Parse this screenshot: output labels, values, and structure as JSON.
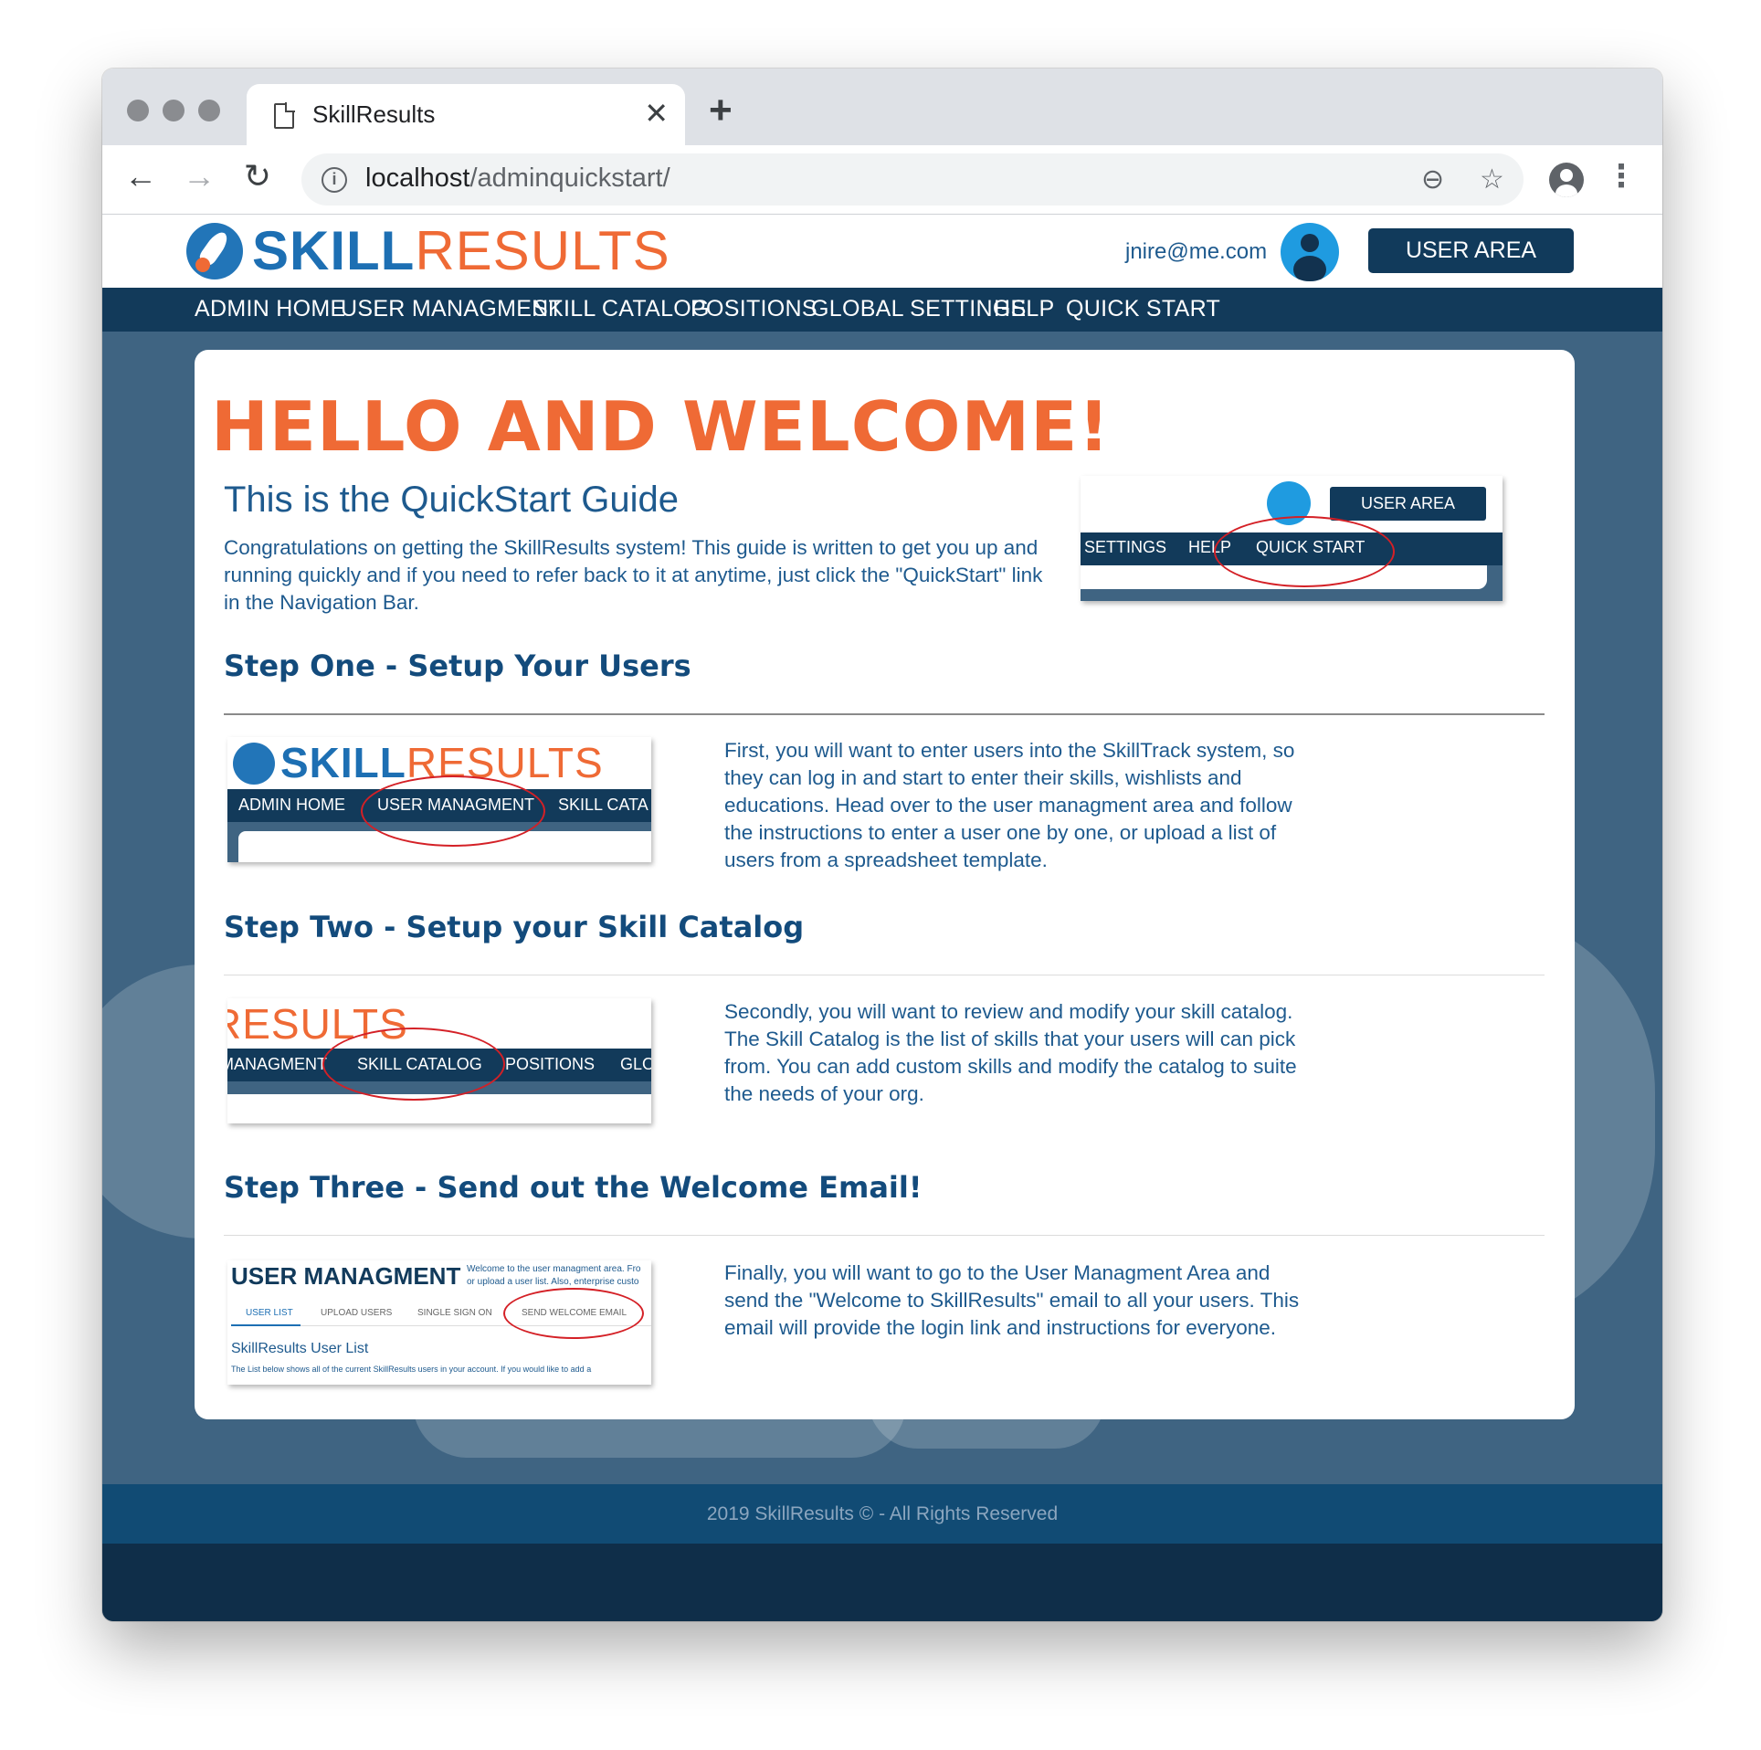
{
  "browser": {
    "tab_title": "SkillResults",
    "tab_close": "✕",
    "new_tab": "+",
    "url_host": "localhost",
    "url_path": "/adminquickstart/",
    "back": "←",
    "forward": "→",
    "reload": "↻",
    "info": "i",
    "zoom_icon": "⊖",
    "star_icon": "☆",
    "menu": "⋮"
  },
  "header": {
    "logo_skill": "SKILL",
    "logo_results": "RESULTS",
    "user_email": "jnire@me.com",
    "user_area_label": "USER AREA"
  },
  "nav": {
    "items": [
      "ADMIN HOME",
      "USER MANAGMENT",
      "SKILL CATALOG",
      "POSITIONS",
      "GLOBAL SETTINGS",
      "HELP",
      "QUICK START"
    ]
  },
  "main": {
    "hero": "HELLO AND WELCOME!",
    "guide_title": "This is the QuickStart Guide",
    "guide_text": "Congratulations on getting the SkillResults system! This guide is written to get you up and running quickly and if you need to refer back to it at anytime, just click the \"QuickStart\" link in the Navigation Bar.",
    "quickstart_thumb": {
      "user_area": "USER AREA",
      "nav": [
        "SETTINGS",
        "HELP",
        "QUICK START"
      ]
    },
    "steps": [
      {
        "title": "Step One - Setup Your Users",
        "text": "First, you will want to enter users into the SkillTrack system, so they can log in and start to enter their skills, wishlists and educations. Head over to the user managment area and follow the instructions to enter a user one by one, or upload a list of users from a spreadsheet template.",
        "thumb": {
          "logo_skill": "SKILL",
          "logo_results": "RESULTS",
          "nav": [
            "ADMIN HOME",
            "USER MANAGMENT",
            "SKILL CATA"
          ]
        }
      },
      {
        "title": "Step Two - Setup your Skill Catalog",
        "text": "Secondly, you will want to review and modify your skill catalog. The Skill Catalog is the list of skills that your users will can pick from. You can add custom skills and modify the catalog to suite the needs of your org.",
        "thumb": {
          "logo_results": "RESULTS",
          "nav": [
            "MANAGMENT",
            "SKILL CATALOG",
            "POSITIONS",
            "GLO"
          ]
        }
      },
      {
        "title": "Step Three - Send out the Welcome Email!",
        "text": "Finally, you will want to go to the User Managment Area and send the \"Welcome to SkillResults\" email to all your users. This email will provide the login link and instructions for everyone.",
        "thumb": {
          "heading": "USER MANAGMENT",
          "blurb_1": "Welcome to the user managment area. Fro",
          "blurb_2": "or upload a user list. Also, enterprise custo",
          "tabs": [
            "USER LIST",
            "UPLOAD USERS",
            "SINGLE SIGN ON",
            "SEND WELCOME EMAIL"
          ],
          "list_title": "SkillResults User List",
          "list_text": "The List below shows all of the current SkillResults users in your account. If you would like to add a"
        }
      }
    ]
  },
  "footer": {
    "text": "2019 SkillResults © - All Rights Reserved"
  }
}
